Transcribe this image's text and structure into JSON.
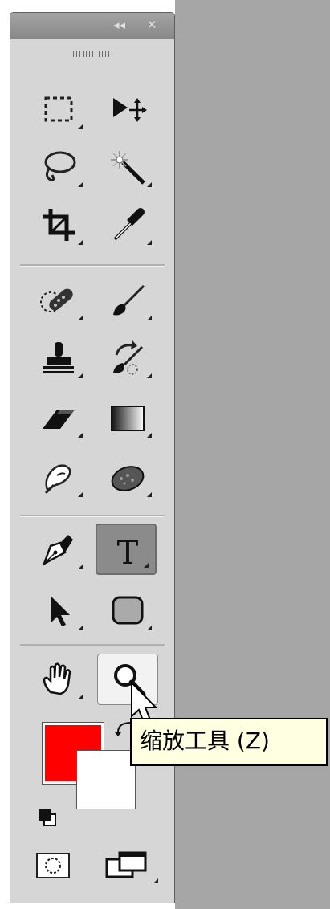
{
  "panel": {
    "collapse_glyph": "◂◂",
    "close_glyph": "✕"
  },
  "tools": [
    {
      "id": "rectangular-marquee",
      "icon": "marquee-icon",
      "active": false
    },
    {
      "id": "move",
      "icon": "move-icon",
      "active": false
    },
    {
      "id": "lasso",
      "icon": "lasso-icon",
      "active": false
    },
    {
      "id": "magic-wand",
      "icon": "magic-wand-icon",
      "active": false
    },
    {
      "id": "crop",
      "icon": "crop-icon",
      "active": false
    },
    {
      "id": "eyedropper",
      "icon": "eyedropper-icon",
      "active": false
    },
    {
      "id": "spot-healing",
      "icon": "bandage-icon",
      "active": false
    },
    {
      "id": "brush",
      "icon": "brush-icon",
      "active": false
    },
    {
      "id": "clone-stamp",
      "icon": "stamp-icon",
      "active": false
    },
    {
      "id": "history-brush",
      "icon": "history-brush-icon",
      "active": false
    },
    {
      "id": "eraser",
      "icon": "eraser-icon",
      "active": false
    },
    {
      "id": "gradient",
      "icon": "gradient-icon",
      "active": false
    },
    {
      "id": "smudge",
      "icon": "smudge-icon",
      "active": false
    },
    {
      "id": "sponge",
      "icon": "sponge-icon",
      "active": false
    },
    {
      "id": "pen",
      "icon": "pen-icon",
      "active": false
    },
    {
      "id": "type",
      "icon": "type-icon",
      "active": true,
      "label": "T"
    },
    {
      "id": "path-selection",
      "icon": "arrow-icon",
      "active": false
    },
    {
      "id": "rounded-rectangle",
      "icon": "rounded-rect-icon",
      "active": false
    },
    {
      "id": "hand",
      "icon": "hand-icon",
      "active": false
    },
    {
      "id": "zoom",
      "icon": "zoom-icon",
      "active": false,
      "hover": true
    }
  ],
  "colors": {
    "foreground": "#ff0000",
    "background": "#ffffff",
    "panel_bg": "#d6d6d6",
    "workspace_bg": "#a6a6a6",
    "tooltip_bg": "#ffffe1"
  },
  "tooltip": {
    "text": "缩放工具 (Z)"
  }
}
